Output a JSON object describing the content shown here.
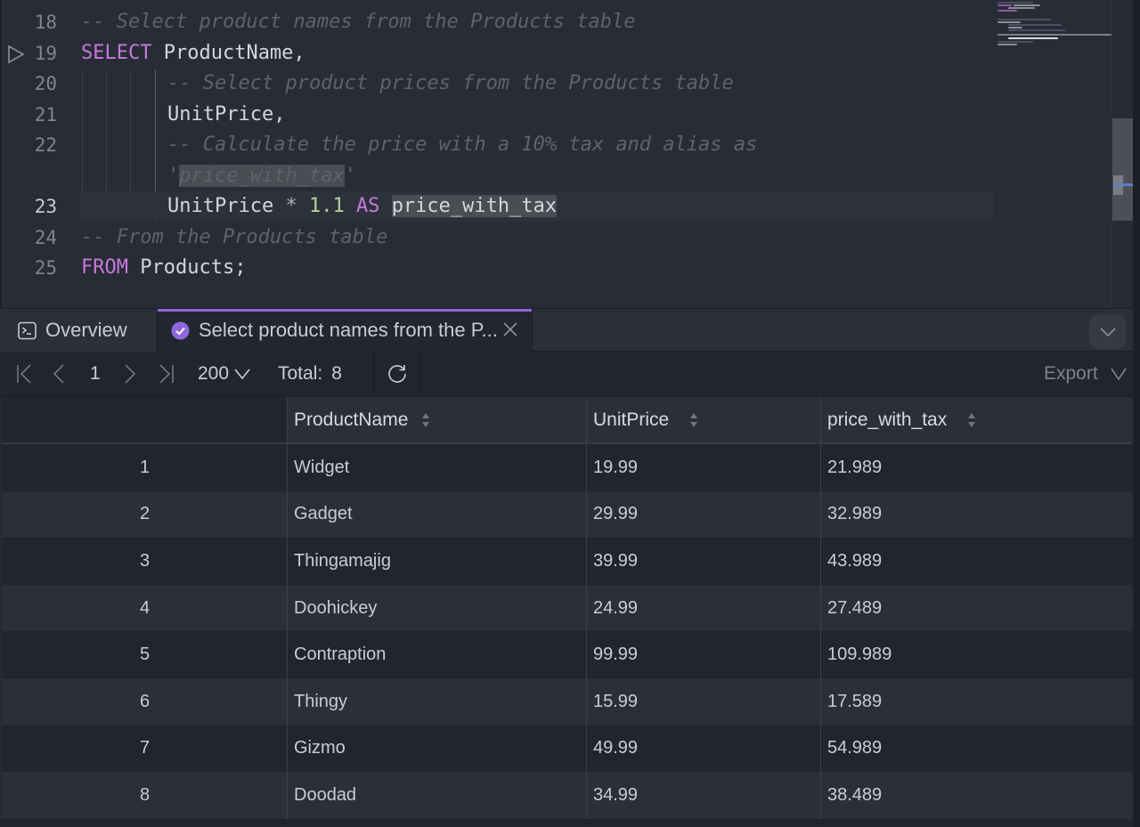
{
  "editor": {
    "lines": [
      {
        "num": "18",
        "tokens": [
          {
            "t": "cm",
            "v": "-- Select product names from the Products table"
          }
        ]
      },
      {
        "num": "19",
        "tokens": [
          {
            "t": "kw",
            "v": "SELECT"
          },
          {
            "t": "tx",
            "v": " ProductName,"
          }
        ]
      },
      {
        "num": "20",
        "tokens": [
          {
            "t": "cm",
            "v": "-- Select product prices from the Products table"
          }
        ]
      },
      {
        "num": "21",
        "tokens": [
          {
            "t": "tx",
            "v": "UnitPrice,"
          }
        ]
      },
      {
        "num": "22",
        "tokens": [
          {
            "t": "cm",
            "v": "-- Calculate the price with a 10% tax and alias as"
          }
        ]
      },
      {
        "num": "",
        "tokens": [
          {
            "t": "cm",
            "v": "'"
          },
          {
            "t": "cm hl",
            "v": "price_with_tax"
          },
          {
            "t": "cm",
            "v": "'"
          }
        ]
      },
      {
        "num": "23",
        "tokens": [
          {
            "t": "tx",
            "v": "UnitPrice "
          },
          {
            "t": "op",
            "v": "*"
          },
          {
            "t": "num",
            "v": " 1.1 "
          },
          {
            "t": "kw",
            "v": "AS"
          },
          {
            "t": "tx",
            "v": " "
          },
          {
            "t": "tx hl",
            "v": "price_with_tax"
          }
        ]
      },
      {
        "num": "24",
        "tokens": [
          {
            "t": "cm",
            "v": "-- From the Products table"
          }
        ]
      },
      {
        "num": "25",
        "tokens": [
          {
            "t": "kw",
            "v": "FROM"
          },
          {
            "t": "tx",
            "v": " Products;"
          }
        ]
      }
    ],
    "current_line": "23",
    "run_line": "19"
  },
  "tabs": {
    "overview_label": "Overview",
    "active_label": "Select product names from the P...",
    "accent_color": "#8f67dd"
  },
  "toolbar": {
    "page": "1",
    "page_size": "200",
    "total_label": "Total:",
    "total_value": "8",
    "export_label": "Export"
  },
  "table": {
    "columns": [
      "ProductName",
      "UnitPrice",
      "price_with_tax"
    ],
    "rows": [
      {
        "idx": "1",
        "cells": [
          "Widget",
          "19.99",
          "21.989"
        ]
      },
      {
        "idx": "2",
        "cells": [
          "Gadget",
          "29.99",
          "32.989"
        ]
      },
      {
        "idx": "3",
        "cells": [
          "Thingamajig",
          "39.99",
          "43.989"
        ]
      },
      {
        "idx": "4",
        "cells": [
          "Doohickey",
          "24.99",
          "27.489"
        ]
      },
      {
        "idx": "5",
        "cells": [
          "Contraption",
          "99.99",
          "109.989"
        ]
      },
      {
        "idx": "6",
        "cells": [
          "Thingy",
          "15.99",
          "17.589"
        ]
      },
      {
        "idx": "7",
        "cells": [
          "Gizmo",
          "49.99",
          "54.989"
        ]
      },
      {
        "idx": "8",
        "cells": [
          "Doodad",
          "34.99",
          "38.489"
        ]
      }
    ]
  }
}
